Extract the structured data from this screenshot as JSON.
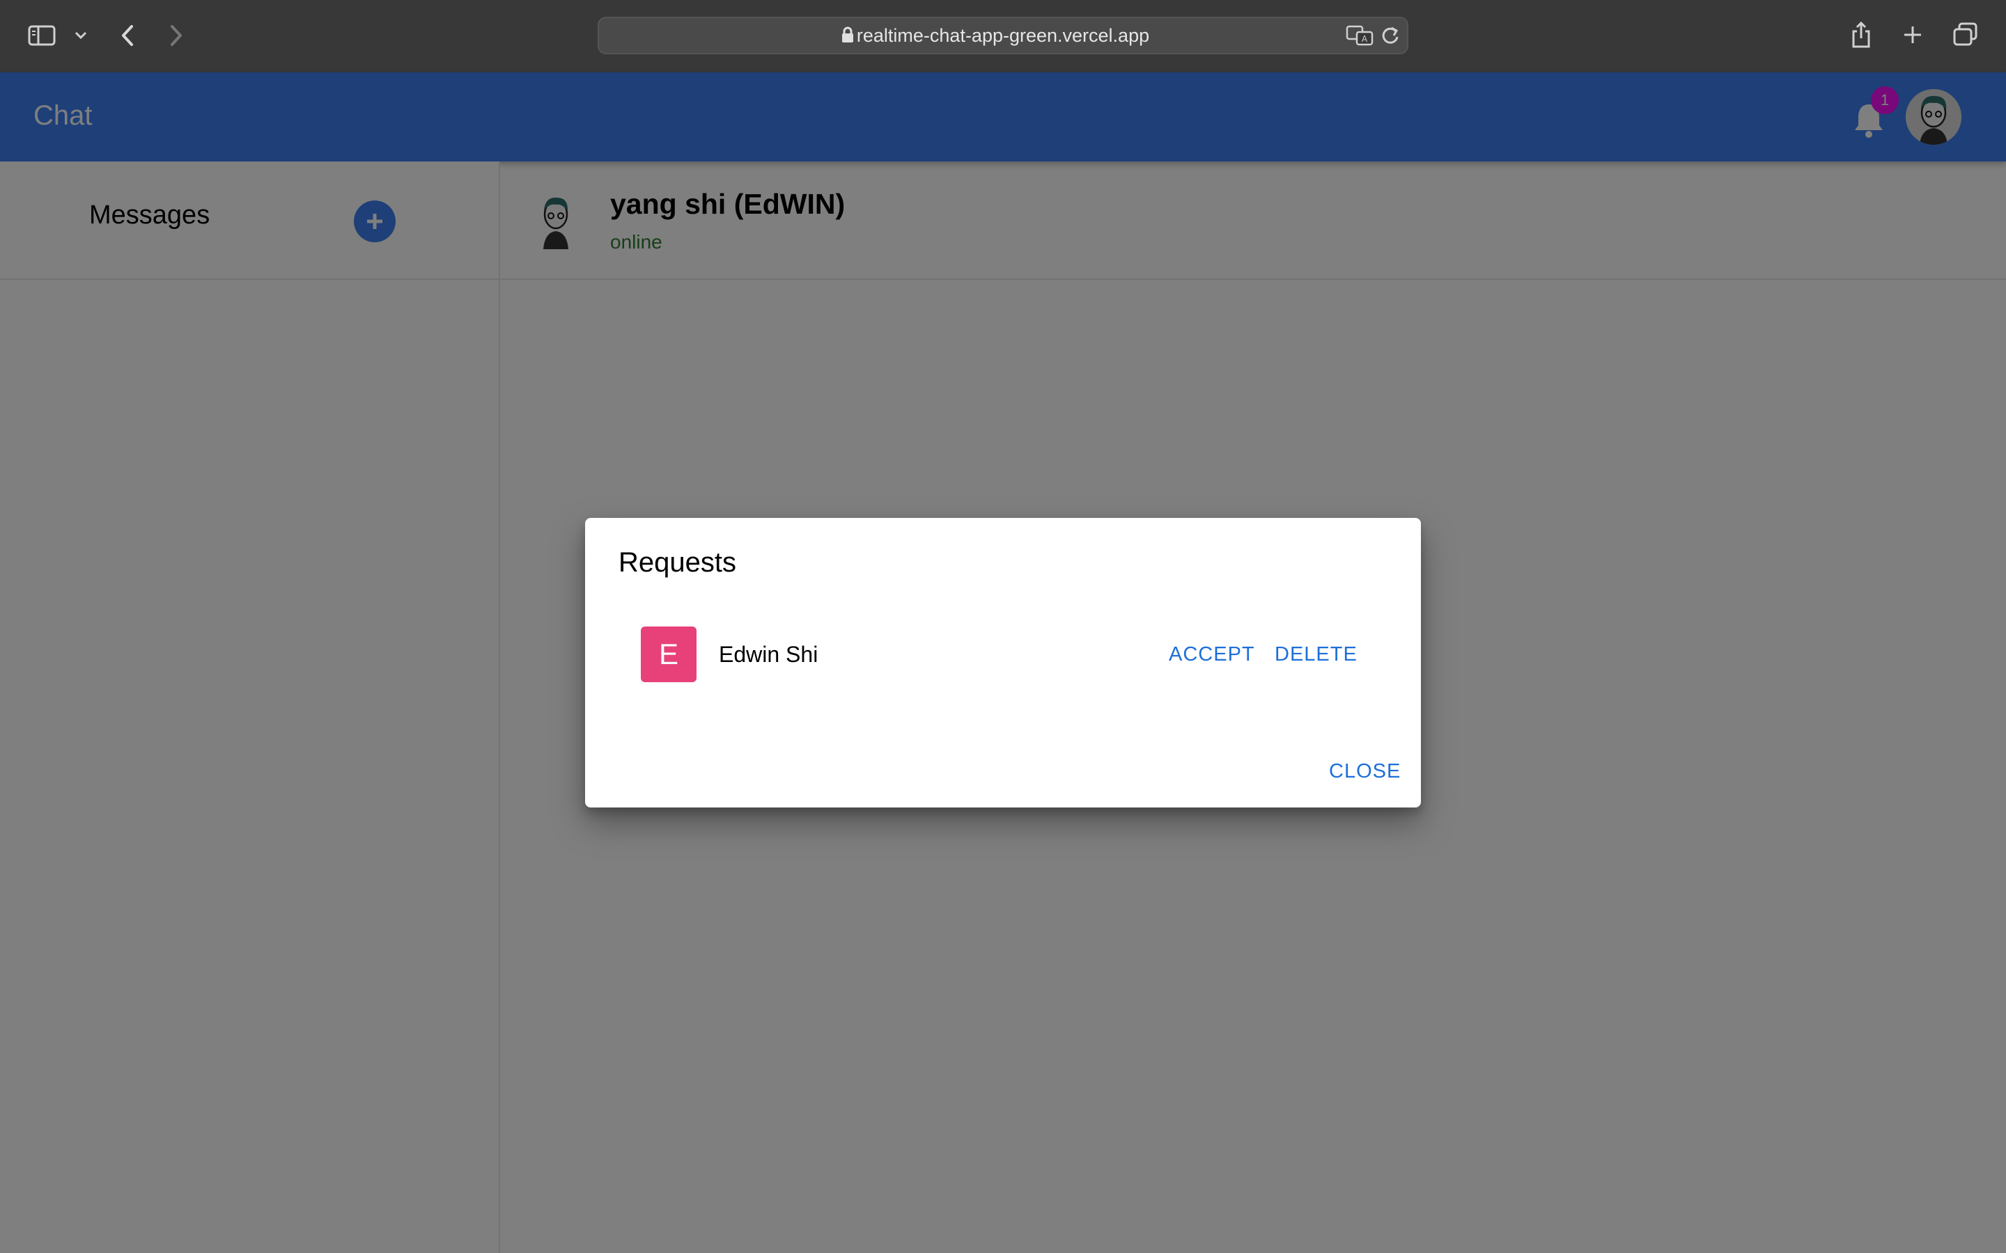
{
  "browser": {
    "url": "realtime-chat-app-green.vercel.app",
    "icons": [
      "sidebar-icon",
      "chevron-down-icon",
      "back-icon",
      "forward-icon",
      "lock-icon",
      "translate-icon",
      "reload-icon",
      "share-icon",
      "new-tab-icon",
      "tabs-overview-icon"
    ]
  },
  "appbar": {
    "title": "Chat",
    "notification_count": "1",
    "accent_color": "#3c7ff1",
    "badge_color": "#f210f6"
  },
  "sidebar": {
    "title": "Messages",
    "add_icon": "plus-icon"
  },
  "chat": {
    "contact_name": "yang shi (EdWIN)",
    "status": "online",
    "status_color": "#2e7d32"
  },
  "dialog": {
    "title": "Requests",
    "requests": [
      {
        "initial": "E",
        "name": "Edwin Shi",
        "avatar_color": "#e8417a",
        "accept_label": "ACCEPT",
        "delete_label": "DELETE"
      }
    ],
    "close_label": "CLOSE",
    "action_color": "#1d6fd8"
  }
}
